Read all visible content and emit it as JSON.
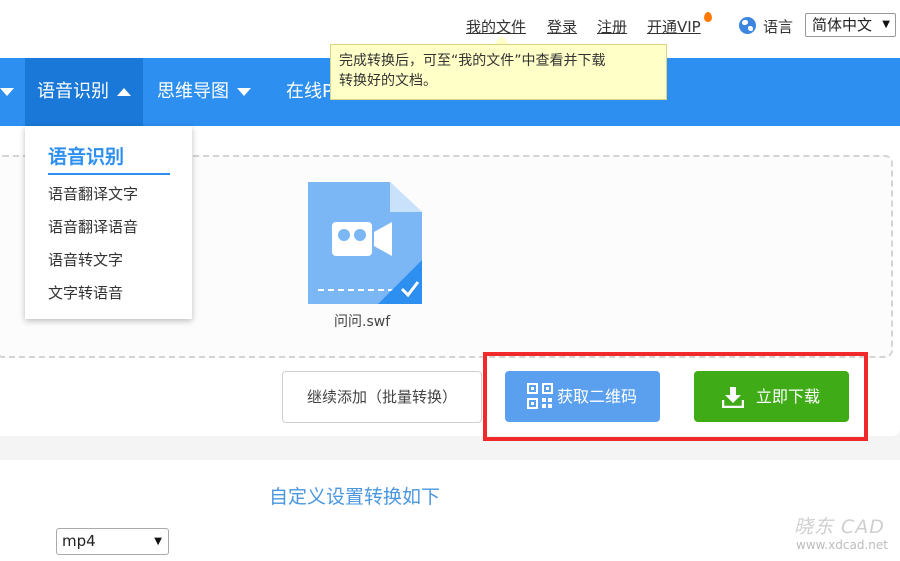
{
  "top_links": {
    "my_files": "我的文件",
    "login": "登录",
    "register": "注册",
    "vip": "开通VIP",
    "language_label": "语言",
    "language_selected": "简体中文"
  },
  "nav": {
    "items": [
      {
        "label": "语音识别"
      },
      {
        "label": "思维导图"
      },
      {
        "label": "在线P"
      }
    ]
  },
  "tooltip": {
    "line1": "完成转换后，可至“我的文件”中查看并下载",
    "line2": "转换好的文档。"
  },
  "dropdown": {
    "title": "语音识别",
    "items": [
      "语音翻译文字",
      "语音翻译语音",
      "语音转文字",
      "文字转语音"
    ]
  },
  "file": {
    "name": "问问.swf"
  },
  "buttons": {
    "continue_label": "继续添加（批量转换）",
    "qr_label": "获取二维码",
    "download_label": "立即下载"
  },
  "settings": {
    "title": "自定义设置转换如下",
    "format_selected": "mp4"
  },
  "watermark": {
    "logo": "晓东 CAD",
    "url": "www.xdcad.net"
  },
  "colors": {
    "nav_blue": "#2d8ff0",
    "download_green": "#3eab17",
    "qr_blue": "#5aa0ee",
    "highlight_red": "#f02a2a",
    "tooltip_yellow": "#ffffc8"
  },
  "icons": {
    "vip": "fire-icon",
    "language": "globe-icon",
    "file": "video-file-icon",
    "check": "check-icon",
    "qr": "qr-code-icon",
    "download": "download-icon"
  }
}
